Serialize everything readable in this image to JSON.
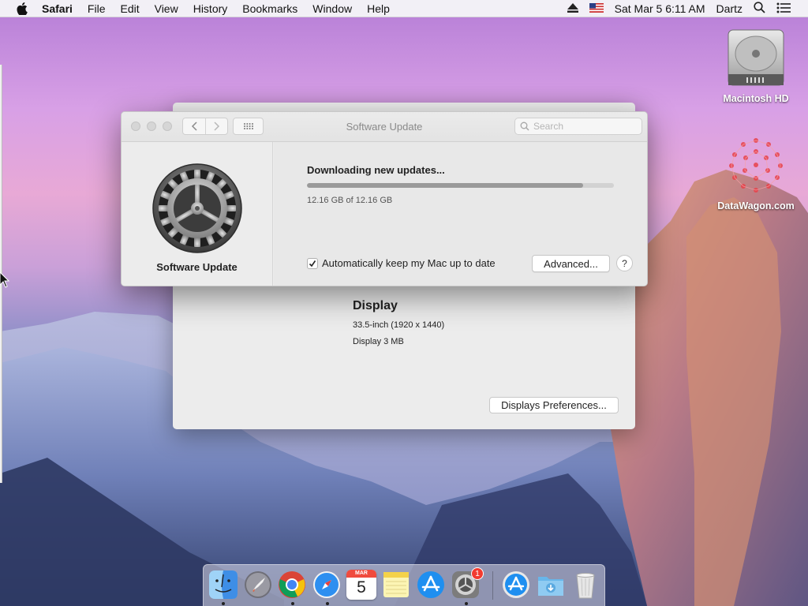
{
  "menubar": {
    "app_name": "Safari",
    "items": [
      "File",
      "Edit",
      "View",
      "History",
      "Bookmarks",
      "Window",
      "Help"
    ],
    "datetime": "Sat Mar 5  6:11 AM",
    "user": "Dartz"
  },
  "desktop": {
    "icons": [
      {
        "label": "Macintosh HD",
        "icon": "hard-drive-icon"
      },
      {
        "label": "DataWagon.com",
        "icon": "datawagon-logo-icon"
      }
    ]
  },
  "back_window": {
    "display_title": "Display",
    "display_spec": "33.5-inch (1920 x 1440)",
    "display_memory": "Display 3 MB",
    "prefs_button": "Displays Preferences..."
  },
  "software_update": {
    "title": "Software Update",
    "search_placeholder": "Search",
    "pane_label": "Software Update",
    "status": "Downloading new updates...",
    "progress": 0.9,
    "size_text": "12.16 GB of 12.16 GB",
    "auto_update_label": "Automatically keep my Mac up to date",
    "auto_update_checked": true,
    "advanced_button": "Advanced...",
    "help_button": "?"
  },
  "dock": {
    "items": [
      "finder",
      "launchpad",
      "chrome",
      "safari",
      "calendar",
      "notes",
      "app-store",
      "system-preferences",
      "app-store-2",
      "downloads",
      "trash"
    ],
    "calendar_month": "MAR",
    "calendar_day": "5",
    "system_preferences_badge": "1"
  },
  "colors": {
    "accent": "#2f7bf5",
    "badge": "#f23b30"
  }
}
